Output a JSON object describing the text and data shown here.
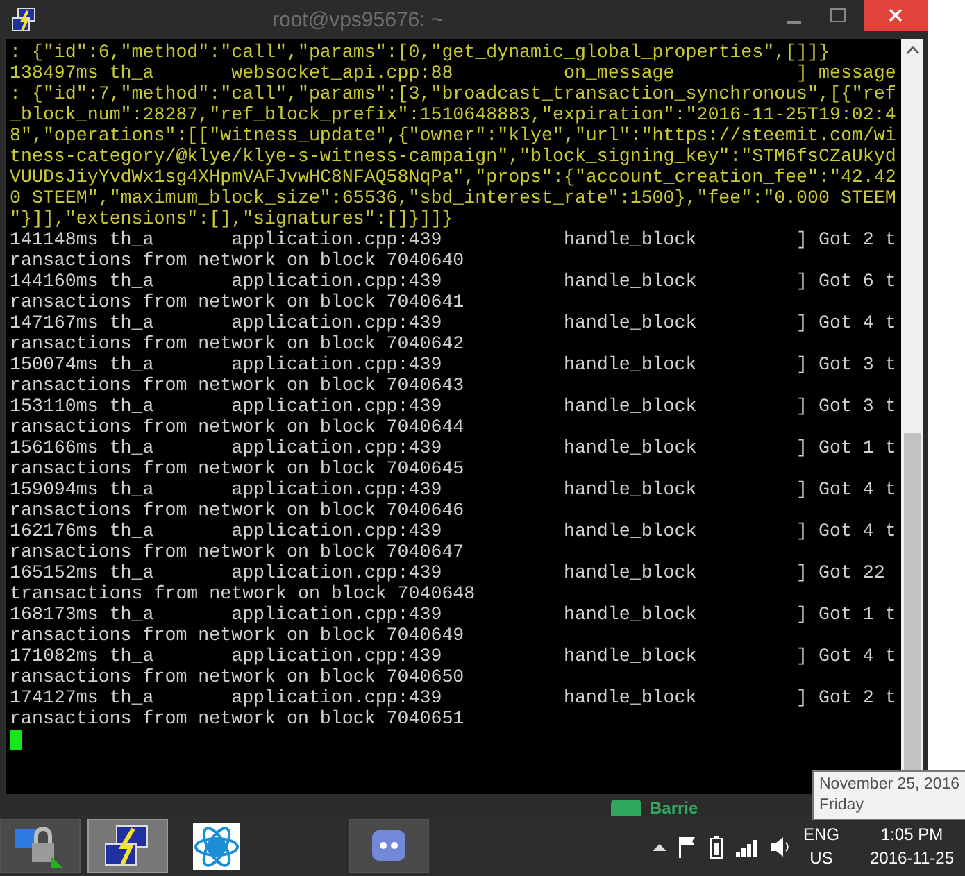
{
  "window": {
    "title": "root@vps95676: ~"
  },
  "terminal": {
    "lines": [
      {
        "kind": "json",
        "text": ": {\"id\":6,\"method\":\"call\",\"params\":[0,\"get_dynamic_global_properties\",[]]}"
      },
      {
        "kind": "json",
        "text": "138497ms th_a       websocket_api.cpp:88          on_message           ] message"
      },
      {
        "kind": "json",
        "text": ": {\"id\":7,\"method\":\"call\",\"params\":[3,\"broadcast_transaction_synchronous\",[{\"ref"
      },
      {
        "kind": "json",
        "text": "_block_num\":28287,\"ref_block_prefix\":1510648883,\"expiration\":\"2016-11-25T19:02:4"
      },
      {
        "kind": "json",
        "text": "8\",\"operations\":[[\"witness_update\",{\"owner\":\"klye\",\"url\":\"https://steemit.com/wi"
      },
      {
        "kind": "json",
        "text": "tness-category/@klye/klye-s-witness-campaign\",\"block_signing_key\":\"STM6fsCZaUkyd"
      },
      {
        "kind": "json",
        "text": "VUUDsJiyYvdWx1sg4XHpmVAFJvwHC8NFAQ58NqPa\",\"props\":{\"account_creation_fee\":\"42.42"
      },
      {
        "kind": "json",
        "text": "0 STEEM\",\"maximum_block_size\":65536,\"sbd_interest_rate\":1500},\"fee\":\"0.000 STEEM"
      },
      {
        "kind": "json",
        "text": "\"}]],\"extensions\":[],\"signatures\":[]}]]}"
      },
      {
        "kind": "log",
        "text": "141148ms th_a       application.cpp:439           handle_block         ] Got 2 t"
      },
      {
        "kind": "log",
        "text": "ransactions from network on block 7040640"
      },
      {
        "kind": "log",
        "text": "144160ms th_a       application.cpp:439           handle_block         ] Got 6 t"
      },
      {
        "kind": "log",
        "text": "ransactions from network on block 7040641"
      },
      {
        "kind": "log",
        "text": "147167ms th_a       application.cpp:439           handle_block         ] Got 4 t"
      },
      {
        "kind": "log",
        "text": "ransactions from network on block 7040642"
      },
      {
        "kind": "log",
        "text": "150074ms th_a       application.cpp:439           handle_block         ] Got 3 t"
      },
      {
        "kind": "log",
        "text": "ransactions from network on block 7040643"
      },
      {
        "kind": "log",
        "text": "153110ms th_a       application.cpp:439           handle_block         ] Got 3 t"
      },
      {
        "kind": "log",
        "text": "ransactions from network on block 7040644"
      },
      {
        "kind": "log",
        "text": "156166ms th_a       application.cpp:439           handle_block         ] Got 1 t"
      },
      {
        "kind": "log",
        "text": "ransactions from network on block 7040645"
      },
      {
        "kind": "log",
        "text": "159094ms th_a       application.cpp:439           handle_block         ] Got 4 t"
      },
      {
        "kind": "log",
        "text": "ransactions from network on block 7040646"
      },
      {
        "kind": "log",
        "text": "162176ms th_a       application.cpp:439           handle_block         ] Got 4 t"
      },
      {
        "kind": "log",
        "text": "ransactions from network on block 7040647"
      },
      {
        "kind": "log",
        "text": "165152ms th_a       application.cpp:439           handle_block         ] Got 22"
      },
      {
        "kind": "log",
        "text": "transactions from network on block 7040648"
      },
      {
        "kind": "log",
        "text": "168173ms th_a       application.cpp:439           handle_block         ] Got 1 t"
      },
      {
        "kind": "log",
        "text": "ransactions from network on block 7040649"
      },
      {
        "kind": "log",
        "text": "171082ms th_a       application.cpp:439           handle_block         ] Got 4 t"
      },
      {
        "kind": "log",
        "text": "ransactions from network on block 7040650"
      },
      {
        "kind": "log",
        "text": "174127ms th_a       application.cpp:439           handle_block         ] Got 2 t"
      },
      {
        "kind": "log",
        "text": "ransactions from network on block 7040651"
      }
    ]
  },
  "notification": {
    "name": "Barrie"
  },
  "taskbar": {
    "apps": [
      {
        "kind": "vpn",
        "selected": false
      },
      {
        "kind": "putty",
        "selected": true
      },
      {
        "kind": "bitcoin",
        "selected": false
      },
      {
        "kind": "discord",
        "selected": false
      }
    ],
    "language": [
      "ENG",
      "US"
    ],
    "time": "1:05 PM",
    "date": "2016-11-25"
  },
  "tooltip": {
    "lines": [
      "November 25, 2016",
      "Friday"
    ]
  }
}
